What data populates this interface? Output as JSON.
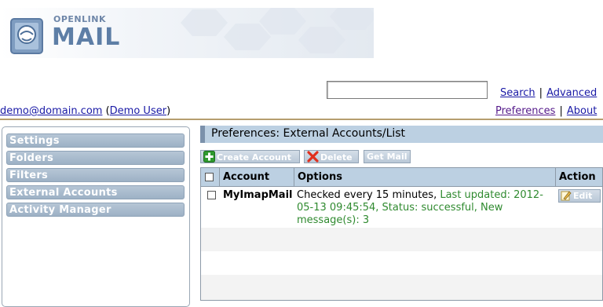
{
  "logo": {
    "line1": "OPENLINK",
    "line2": "MAIL"
  },
  "search": {
    "value": "",
    "placeholder": "",
    "search_link": "Search",
    "advanced_link": "Advanced"
  },
  "user": {
    "email": "demo@domain.com",
    "name": "Demo User"
  },
  "top_links": {
    "preferences": "Preferences",
    "about": "About"
  },
  "sidebar": {
    "items": [
      {
        "label": "Settings"
      },
      {
        "label": "Folders"
      },
      {
        "label": "Filters"
      },
      {
        "label": "External Accounts"
      },
      {
        "label": "Activity Manager"
      }
    ]
  },
  "panel": {
    "title": "Preferences: External Accounts/List"
  },
  "toolbar": {
    "create_label": "Create Account",
    "delete_label": "Delete",
    "getmail_label": "Get Mail"
  },
  "table": {
    "headers": {
      "account": "Account",
      "options": "Options",
      "action": "Action"
    },
    "rows": [
      {
        "account": "MyImapMail",
        "options_check": "Checked every 15 minutes,",
        "options_status": "Last updated: 2012-05-13 09:45:54, Status: successful, New message(s): 3",
        "action": "Edit"
      }
    ]
  },
  "colors": {
    "header_rule": "#b69e6e",
    "panel_bg": "#bcd0e2",
    "button_bg": "#b9c8d7",
    "status_green": "#2f8a2f",
    "link": "#1a1aa6"
  }
}
